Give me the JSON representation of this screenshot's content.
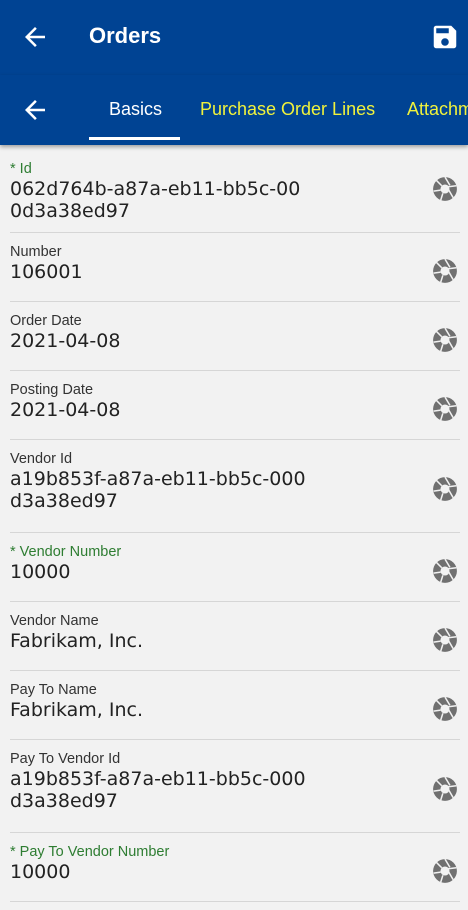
{
  "header": {
    "title": "Orders"
  },
  "tabs": [
    {
      "label": "Basics",
      "active": true
    },
    {
      "label": "Purchase Order Lines",
      "active": false
    },
    {
      "label": "Attachments",
      "active": false
    }
  ],
  "colors": {
    "appbar": "#004393",
    "inactive_tab": "#f0f23c",
    "required_label": "#2e7d32"
  },
  "fields": [
    {
      "label": "* Id",
      "value": "062d764b-a87a-eb11-bb5c-000d3a38ed97",
      "required": true
    },
    {
      "label": "Number",
      "value": "106001",
      "required": false
    },
    {
      "label": "Order Date",
      "value": "2021-04-08",
      "required": false
    },
    {
      "label": "Posting Date",
      "value": "2021-04-08",
      "required": false
    },
    {
      "label": "Vendor Id",
      "value": "a19b853f-a87a-eb11-bb5c-000d3a38ed97",
      "required": false
    },
    {
      "label": "* Vendor Number",
      "value": "10000",
      "required": true
    },
    {
      "label": "Vendor Name",
      "value": "Fabrikam, Inc.",
      "required": false
    },
    {
      "label": "Pay To Name",
      "value": "Fabrikam, Inc.",
      "required": false
    },
    {
      "label": "Pay To Vendor Id",
      "value": "a19b853f-a87a-eb11-bb5c-000d3a38ed97",
      "required": false
    },
    {
      "label": "* Pay To Vendor Number",
      "value": "10000",
      "required": true
    }
  ]
}
